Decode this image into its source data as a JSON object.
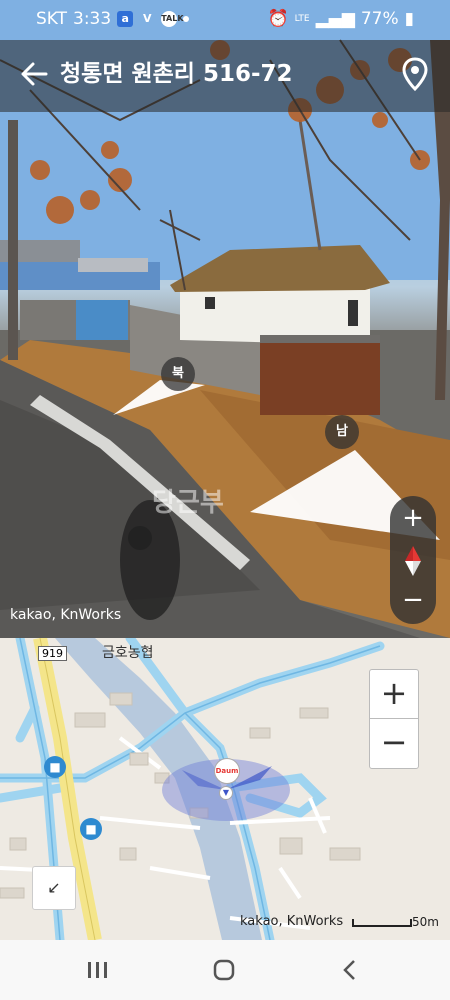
{
  "status_bar": {
    "carrier": "SKT",
    "time": "3:33",
    "network": "LTE",
    "battery": "77%"
  },
  "header": {
    "title": "청통면 원촌리 516-72"
  },
  "roadview": {
    "dir_north": "북",
    "dir_south": "남",
    "watermark": "당근부",
    "credit": "kakao, KnWorks",
    "zoom_in": "+",
    "zoom_out": "−"
  },
  "map": {
    "road_number": "919",
    "place": "금호농협",
    "credit": "kakao, KnWorks",
    "scale": "50m",
    "zoom_in": "+",
    "zoom_out": "−"
  },
  "colors": {
    "road_blue": "#9fd4f0",
    "road_yellow": "#f4e58a",
    "selected_fov": "#6f7fd6"
  }
}
